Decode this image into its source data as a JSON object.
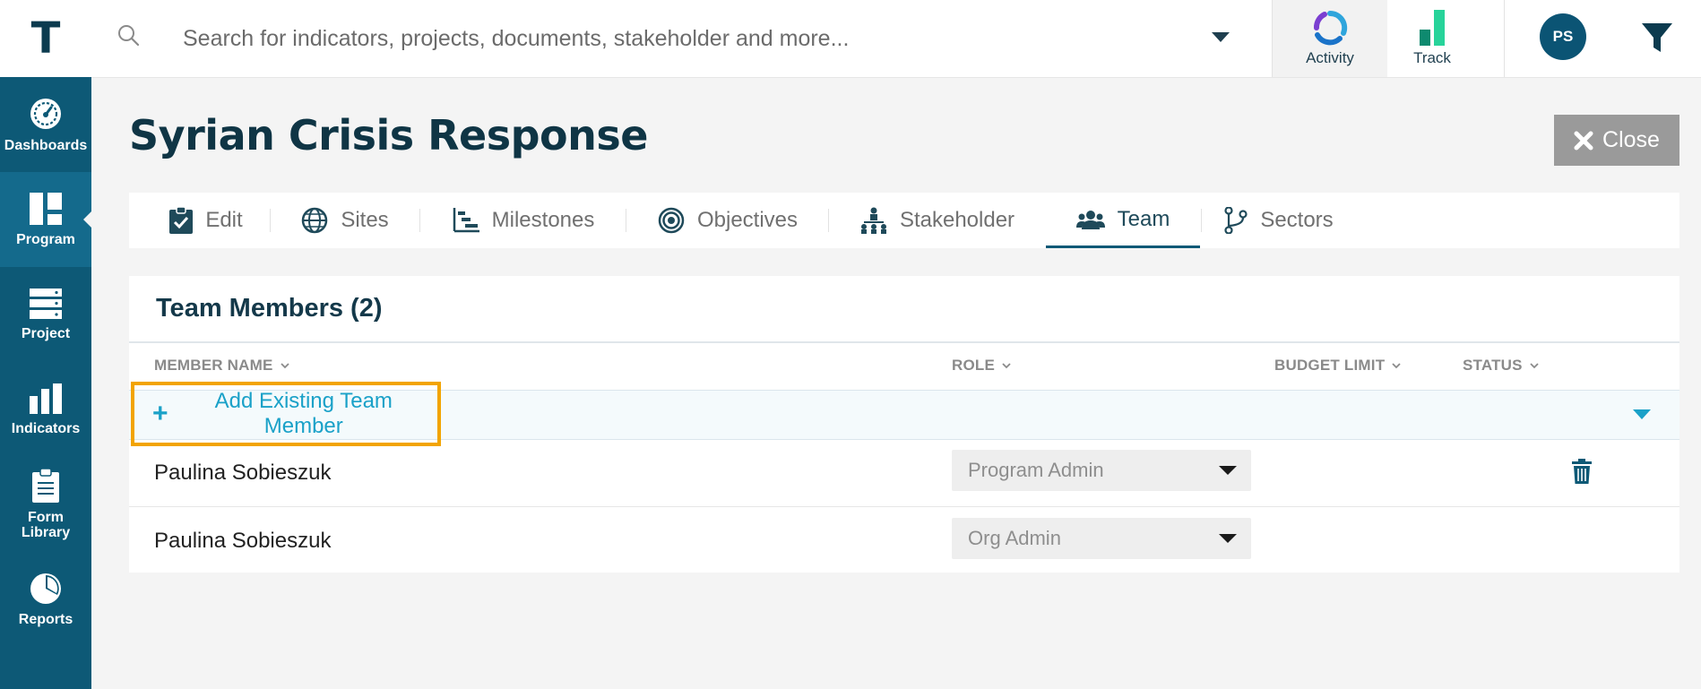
{
  "app": {
    "logo_letter": "T"
  },
  "search": {
    "placeholder": "Search for indicators, projects, documents, stakeholder and more..."
  },
  "topnav": {
    "activity_label": "Activity",
    "track_label": "Track",
    "avatar_initials": "PS"
  },
  "sidebar": {
    "items": [
      {
        "label": "Dashboards",
        "icon": "speedometer-icon"
      },
      {
        "label": "Program",
        "icon": "grid-icon",
        "active": true
      },
      {
        "label": "Project",
        "icon": "server-icon"
      },
      {
        "label": "Indicators",
        "icon": "bar-chart-icon"
      },
      {
        "label": "Form Library",
        "icon": "clipboard-icon"
      },
      {
        "label": "Reports",
        "icon": "pie-chart-icon"
      }
    ]
  },
  "page": {
    "title": "Syrian Crisis Response",
    "close_label": "Close"
  },
  "tabs": [
    {
      "label": "Edit",
      "icon": "clipboard-check-icon"
    },
    {
      "label": "Sites",
      "icon": "globe-icon"
    },
    {
      "label": "Milestones",
      "icon": "gantt-icon"
    },
    {
      "label": "Objectives",
      "icon": "target-icon"
    },
    {
      "label": "Stakeholder",
      "icon": "hierarchy-icon"
    },
    {
      "label": "Team",
      "icon": "users-icon",
      "active": true
    },
    {
      "label": "Sectors",
      "icon": "branch-icon"
    }
  ],
  "team": {
    "title": "Team Members (2)",
    "columns": {
      "name": "MEMBER NAME",
      "role": "ROLE",
      "budget": "BUDGET LIMIT",
      "status": "STATUS"
    },
    "add_label": "Add Existing Team Member",
    "members": [
      {
        "name": "Paulina Sobieszuk",
        "role": "Program Admin"
      },
      {
        "name": "Paulina Sobieszuk",
        "role": "Org Admin"
      }
    ]
  },
  "colors": {
    "sidebar": "#0d5976",
    "accent": "#1aa1c8",
    "highlight": "#f2a400",
    "title": "#0f3545"
  }
}
